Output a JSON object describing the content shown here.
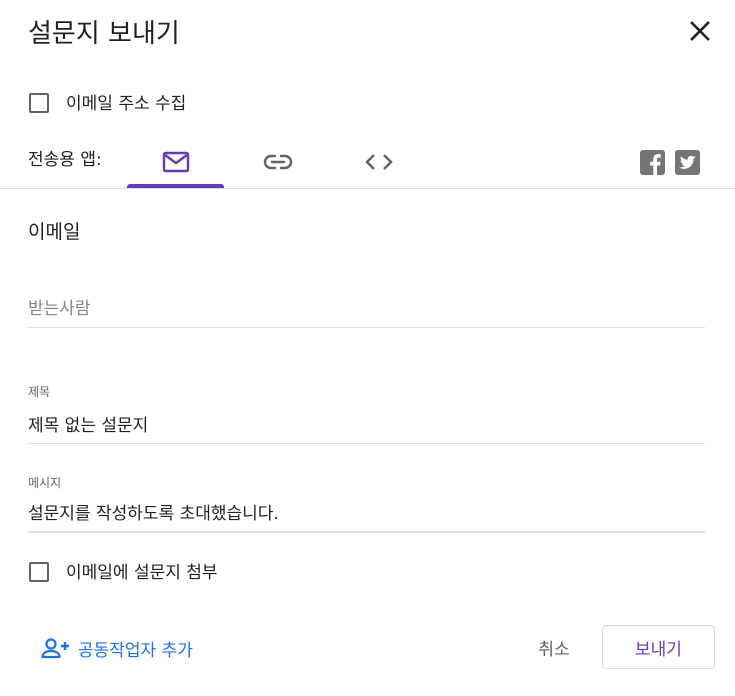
{
  "dialog": {
    "title": "설문지 보내기",
    "close_icon": "close-icon"
  },
  "collect_email": {
    "label": "이메일 주소 수집",
    "checked": false
  },
  "send_via": {
    "label": "전송용 앱:",
    "tabs": [
      {
        "name": "email",
        "icon": "mail-icon",
        "active": true
      },
      {
        "name": "link",
        "icon": "link-icon",
        "active": false
      },
      {
        "name": "embed",
        "icon": "code-icon",
        "active": false
      }
    ],
    "social": [
      {
        "name": "facebook",
        "icon": "facebook-icon"
      },
      {
        "name": "twitter",
        "icon": "twitter-icon"
      }
    ]
  },
  "email_form": {
    "heading": "이메일",
    "to": {
      "placeholder": "받는사람",
      "value": ""
    },
    "subject": {
      "label": "제목",
      "value": "제목 없는 설문지"
    },
    "message": {
      "label": "메시지",
      "value": "설문지를 작성하도록 초대했습니다."
    },
    "include_form": {
      "label": "이메일에 설문지 첨부",
      "checked": false
    }
  },
  "footer": {
    "add_collaborators": "공동작업자 추가",
    "cancel": "취소",
    "send": "보내기"
  },
  "colors": {
    "accent": "#673ab7",
    "link": "#1a73e8",
    "text": "#202124",
    "muted": "#5f6368",
    "divider": "#dadce0"
  }
}
